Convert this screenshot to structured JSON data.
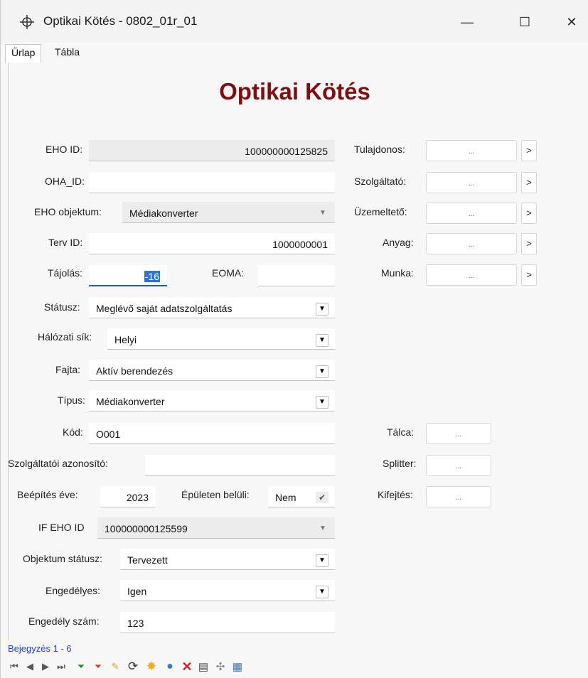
{
  "window": {
    "title": "Optikai Kötés - 0802_01r_01",
    "minimize": "—",
    "maximize": "☐",
    "close": "✕",
    "icon": "move-icon"
  },
  "tabs": [
    {
      "label": "Űrlap"
    },
    {
      "label": "Tábla"
    }
  ],
  "form": {
    "title": "Optikai Kötés",
    "eho_id": {
      "label": "EHO ID:",
      "value": "100000000125825"
    },
    "oha_id": {
      "label": "OHA_ID:",
      "value": ""
    },
    "eho_objektum": {
      "label": "EHO objektum:",
      "value": "Médiakonverter"
    },
    "terv_id": {
      "label": "Terv ID:",
      "value": "1000000001"
    },
    "tajolas": {
      "label": "Tájolás:",
      "value": "-16"
    },
    "eoma": {
      "label": "EOMA:",
      "value": ""
    },
    "statusz": {
      "label": "Státusz:",
      "value": "Meglévő saját adatszolgáltatás"
    },
    "halozati_sik": {
      "label": "Hálózati sík:",
      "value": "Helyi"
    },
    "fajta": {
      "label": "Fajta:",
      "value": "Aktív berendezés"
    },
    "tipus": {
      "label": "Típus:",
      "value": "Médiakonverter"
    },
    "kod": {
      "label": "Kód:",
      "value": "O001"
    },
    "szolg_azon": {
      "label": "Szolgáltatói azonosító:",
      "value": ""
    },
    "beepites_eve": {
      "label": "Beépítés éve:",
      "value": "2023"
    },
    "epuleten_beluli": {
      "label": "Épületen belüli:",
      "value": "Nem"
    },
    "if_eho_id": {
      "label": "IF EHO ID",
      "value": "100000000125599"
    },
    "objektum_statusz": {
      "label": "Objektum státusz:",
      "value": "Tervezett"
    },
    "engedelyes": {
      "label": "Engedélyes:",
      "value": "Igen"
    },
    "engedely_szam": {
      "label": "Engedély szám:",
      "value": "123"
    }
  },
  "right": {
    "tulajdonos": {
      "label": "Tulajdonos:",
      "btn": "...",
      "go": ">"
    },
    "szolgaltato": {
      "label": "Szolgáltató:",
      "btn": "...",
      "go": ">"
    },
    "uzemelteto": {
      "label": "Üzemeltető:",
      "btn": "...",
      "go": ">"
    },
    "anyag": {
      "label": "Anyag:",
      "btn": "...",
      "go": ">"
    },
    "munka": {
      "label": "Munka:",
      "btn": "...",
      "go": ">"
    },
    "talca": {
      "label": "Tálca:",
      "btn": "..."
    },
    "splitter": {
      "label": "Splitter:",
      "btn": "..."
    },
    "kifejtes": {
      "label": "Kifejtés:",
      "btn": "..."
    }
  },
  "status": {
    "text": "Bejegyzés 1 - 6"
  },
  "colors": {
    "title": "#7d0f12",
    "status": "#1b46c4"
  }
}
